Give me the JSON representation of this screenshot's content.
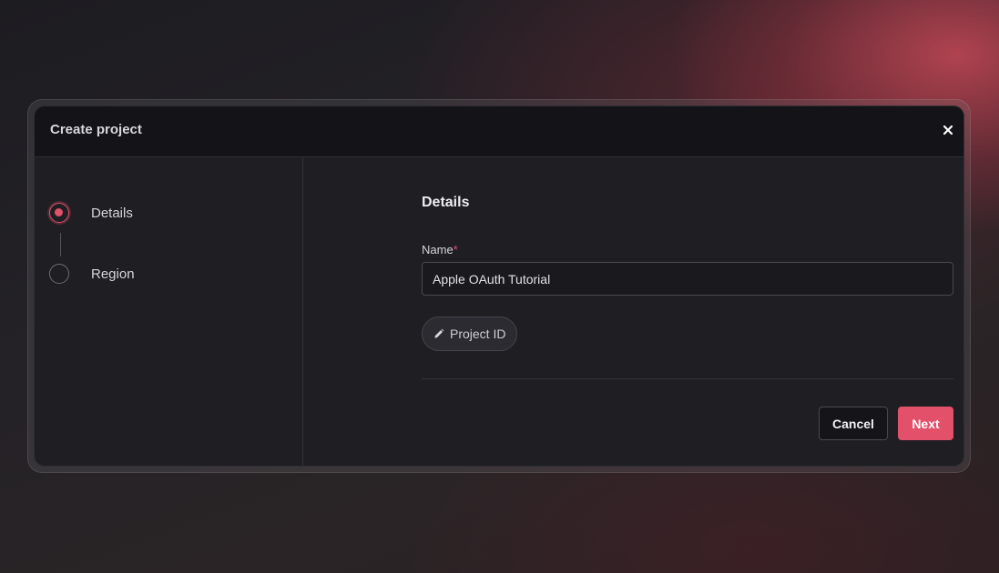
{
  "modal": {
    "title": "Create project",
    "close_icon": "close-icon"
  },
  "steps": [
    {
      "label": "Details",
      "state": "active"
    },
    {
      "label": "Region",
      "state": "inactive"
    }
  ],
  "form": {
    "section_title": "Details",
    "name_label": "Name",
    "required_marker": "*",
    "name_value": "Apple OAuth Tutorial",
    "project_id_label": "Project ID",
    "project_id_icon": "pencil-icon"
  },
  "actions": {
    "cancel_label": "Cancel",
    "next_label": "Next"
  },
  "colors": {
    "accent": "#e3506a",
    "modal_bg": "#1f1e23",
    "header_bg": "#141317"
  }
}
